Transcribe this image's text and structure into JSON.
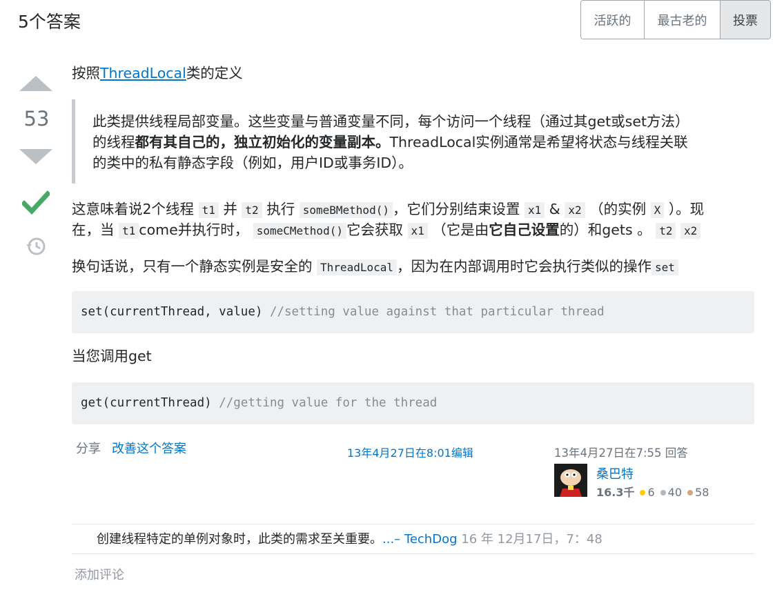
{
  "header": {
    "answers_count_title": "5个答案",
    "sort_tabs": [
      "活跃的",
      "最古老的",
      "投票"
    ],
    "active_tab": "投票"
  },
  "vote": {
    "score": "53",
    "accepted": true,
    "icons": {
      "up": "arrow-up-icon",
      "down": "arrow-down-icon",
      "accepted": "checkmark-icon",
      "history": "history-icon"
    }
  },
  "post": {
    "p1_prefix": "按照",
    "p1_link": "ThreadLocal",
    "p1_suffix": "类的定义",
    "quote_l1": "此类提供线程局部变量。这些变量与普通变量不同，每个访问一个线程（通过其get或set方法）",
    "quote_l2_prefix": "的线程",
    "quote_l2_bold": "都有其自己的，独立初始化的变量副本。",
    "quote_l2_suffix": "ThreadLocal实例通常是希望将状态与线程关联",
    "quote_l3": "的类中的私有静态字段（例如，用户ID或事务ID）。",
    "p2_a": "这意味着说2个线程",
    "c_t1": "t1",
    "p2_b": "并",
    "c_t2": "t2",
    "p2_c": "执行",
    "c_someB": "someBMethod()",
    "p2_d": "，它们分别结束设置",
    "c_x1": "x1",
    "p2_e": "&",
    "c_x2": "x2",
    "p2_f": "（的实例",
    "c_X": "X",
    "p2_g": "）。现",
    "p3_a": "在，当",
    "p3_b": "come并执行时，",
    "c_someC": "someCMethod()",
    "p3_c": "它会获取",
    "p3_d": "（它是由",
    "p3_bold": "它自己设置",
    "p3_e": "的）和gets 。",
    "p4_a": "换句话说，只有一个静态实例是安全的",
    "c_threadlocal": "ThreadLocal",
    "p4_b": "，因为在内部调用时它会执行类似的操作",
    "c_set": "set",
    "code1": "set(currentThread, value)",
    "code1_comment": "//setting value against that particular thread",
    "p5": "当您调用get",
    "code2": "get(currentThread)",
    "code2_comment": "//getting value for the thread"
  },
  "meta": {
    "share": "分享",
    "improve": "改善这个答案",
    "edited": "13年4月27日在8:01编辑",
    "answered": "13年4月27日在7:55 回答",
    "user_name": "桑巴特",
    "reputation": "16.3千",
    "gold": "6",
    "silver": "40",
    "bronze": "58"
  },
  "comment": {
    "text": "创建线程特定的单例对象时，此类的需求至关重要。",
    "ellipsis_author": "...– TechDog",
    "age": "16 年",
    "date": "12月17日，7：48",
    "add_comment": "添加评论"
  }
}
